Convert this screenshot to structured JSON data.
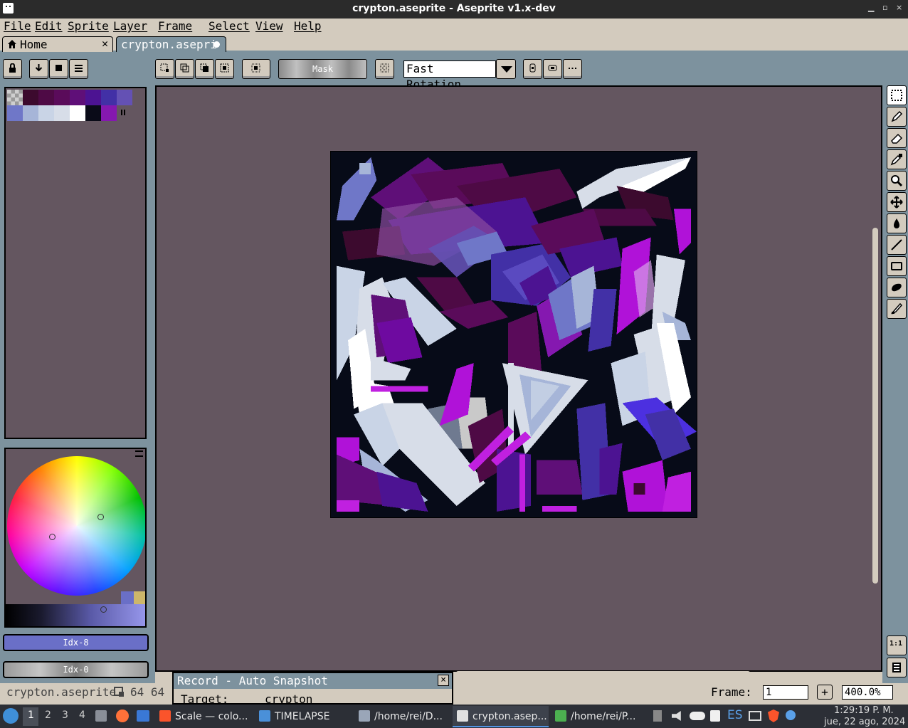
{
  "window": {
    "title": "crypton.aseprite - Aseprite v1.x-dev",
    "minimize": "▁",
    "maximize": "▫",
    "close": "×"
  },
  "menu": {
    "items": [
      "File",
      "Edit",
      "Sprite",
      "Layer",
      "Frame",
      "Select",
      "View",
      "Help"
    ]
  },
  "tabs": [
    {
      "label": "Home",
      "icon": "home-icon",
      "close": "✕"
    },
    {
      "label": "crypton.asepri",
      "active": true
    }
  ],
  "toolbar": {
    "mask_label": "Mask",
    "rotation_algorithm": "Fast Rotation"
  },
  "palette": {
    "colors": [
      "#3c0a2e",
      "#4e0a45",
      "#5a0b5a",
      "#5f0f78",
      "#4c1392",
      "#4230a6",
      "#6451b4",
      "#6f77c8",
      "#a6b5d8",
      "#c9d4e6",
      "#d7dde8",
      "#ffffff",
      "#0a0b18",
      "#8518b0"
    ],
    "accent": "#6a6fc7"
  },
  "color_selector": {
    "fg_label": "Idx-8",
    "bg_label": "Idx-0"
  },
  "record_panel": {
    "title": "Record - Auto Snapshot",
    "target_label": "Target:",
    "target_value": "crypton"
  },
  "status": {
    "filename": "crypton.aseprite",
    "size": "64 64",
    "frame_label": "Frame:",
    "frame_value": "1",
    "zoom": "400.0%"
  },
  "taskbar": {
    "workspaces": [
      "1",
      "2",
      "3",
      "4"
    ],
    "tasks": [
      {
        "label": "Scale — colo...",
        "icon": "brave-icon"
      },
      {
        "label": "TIMELAPSE",
        "icon": "folder-icon"
      },
      {
        "label": "/home/rei/D...",
        "icon": "editor-icon"
      },
      {
        "label": "crypton.asep...",
        "icon": "aseprite-icon",
        "active": true
      },
      {
        "label": "/home/rei/P...",
        "icon": "image-viewer-icon"
      }
    ],
    "keyboard_layout": "ES",
    "time": "1:29:19 P. M.",
    "date": "jue, 22 ago, 2024"
  }
}
